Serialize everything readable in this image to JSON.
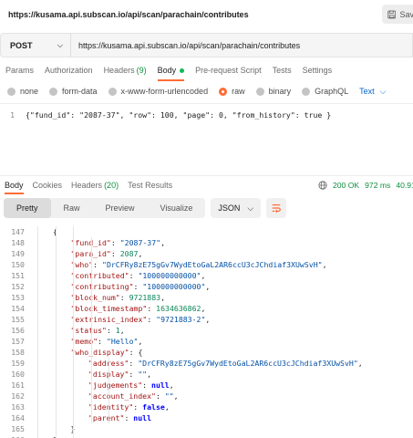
{
  "window": {
    "title": "https://kusama.api.subscan.io/api/scan/parachain/contributes",
    "save_label": "Save"
  },
  "request": {
    "method": "POST",
    "url": "https://kusama.api.subscan.io/api/scan/parachain/contributes"
  },
  "request_tabs": [
    {
      "label": "Params"
    },
    {
      "label": "Authorization"
    },
    {
      "label": "Headers",
      "count": "(9)"
    },
    {
      "label": "Body",
      "active": true
    },
    {
      "label": "Pre-request Script"
    },
    {
      "label": "Tests"
    },
    {
      "label": "Settings"
    }
  ],
  "body_types": [
    {
      "label": "none"
    },
    {
      "label": "form-data"
    },
    {
      "label": "x-www-form-urlencoded"
    },
    {
      "label": "raw",
      "checked": true
    },
    {
      "label": "binary"
    },
    {
      "label": "GraphQL"
    }
  ],
  "lang_select": "Text",
  "editor": {
    "line_number": "1",
    "content": "{\"fund_id\": \"2087-37\", \"row\": 100, \"page\": 0, \"from_history\": true }"
  },
  "response_tabs": [
    {
      "label": "Body",
      "active": true
    },
    {
      "label": "Cookies"
    },
    {
      "label": "Headers",
      "count": "(20)"
    },
    {
      "label": "Test Results"
    }
  ],
  "response_status": {
    "status": "200 OK",
    "time": "972 ms",
    "size": "40.91"
  },
  "view_tabs": [
    {
      "label": "Pretty",
      "active": true
    },
    {
      "label": "Raw"
    },
    {
      "label": "Preview"
    },
    {
      "label": "Visualize"
    }
  ],
  "format_select": "JSON",
  "response_lines": [
    {
      "n": "147",
      "indent": 4,
      "text": "{"
    },
    {
      "n": "148",
      "indent": 5,
      "key": "\"fund_id\"",
      "val": "\"2087-37\"",
      "vt": "s",
      "tail": ","
    },
    {
      "n": "149",
      "indent": 5,
      "key": "\"para_id\"",
      "val": "2087",
      "vt": "n",
      "tail": ","
    },
    {
      "n": "150",
      "indent": 5,
      "key": "\"who\"",
      "val": "\"DrCFRy8zE75gGv7WydEtoGaL2AR6ccU3cJChdiaf3XUwSvH\"",
      "vt": "s",
      "tail": ","
    },
    {
      "n": "151",
      "indent": 5,
      "key": "\"contributed\"",
      "val": "\"100000000000\"",
      "vt": "s",
      "tail": ","
    },
    {
      "n": "152",
      "indent": 5,
      "key": "\"contributing\"",
      "val": "\"100000000000\"",
      "vt": "s",
      "tail": ","
    },
    {
      "n": "153",
      "indent": 5,
      "key": "\"block_num\"",
      "val": "9721883",
      "vt": "n",
      "tail": ","
    },
    {
      "n": "154",
      "indent": 5,
      "key": "\"block_timestamp\"",
      "val": "1634636862",
      "vt": "n",
      "tail": ","
    },
    {
      "n": "155",
      "indent": 5,
      "key": "\"extrinsic_index\"",
      "val": "\"9721883-2\"",
      "vt": "s",
      "tail": ","
    },
    {
      "n": "156",
      "indent": 5,
      "key": "\"status\"",
      "val": "1",
      "vt": "n",
      "tail": ","
    },
    {
      "n": "157",
      "indent": 5,
      "key": "\"memo\"",
      "val": "\"Hello\"",
      "vt": "s",
      "tail": ","
    },
    {
      "n": "158",
      "indent": 5,
      "key": "\"who_display\"",
      "val": "{",
      "vt": "p",
      "tail": ""
    },
    {
      "n": "159",
      "indent": 6,
      "key": "\"address\"",
      "val": "\"DrCFRy8zE75gGv7WydEtoGaL2AR6ccU3cJChdiaf3XUwSvH\"",
      "vt": "s",
      "tail": ","
    },
    {
      "n": "160",
      "indent": 6,
      "key": "\"display\"",
      "val": "\"\"",
      "vt": "s",
      "tail": ","
    },
    {
      "n": "161",
      "indent": 6,
      "key": "\"judgements\"",
      "val": "null",
      "vt": "k",
      "tail": ","
    },
    {
      "n": "162",
      "indent": 6,
      "key": "\"account_index\"",
      "val": "\"\"",
      "vt": "s",
      "tail": ","
    },
    {
      "n": "163",
      "indent": 6,
      "key": "\"identity\"",
      "val": "false",
      "vt": "k",
      "tail": ","
    },
    {
      "n": "164",
      "indent": 6,
      "key": "\"parent\"",
      "val": "null",
      "vt": "k",
      "tail": ""
    },
    {
      "n": "165",
      "indent": 5,
      "text": "}"
    },
    {
      "n": "166",
      "indent": 4,
      "text": "},"
    }
  ],
  "colors": {
    "accent": "#ff6c37",
    "success": "#0f8f3e",
    "link": "#0265d2"
  }
}
